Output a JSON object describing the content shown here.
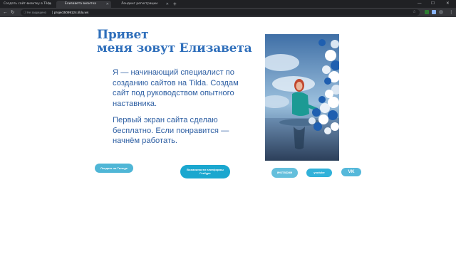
{
  "browser": {
    "tabs": [
      {
        "label": "Создать сайт-визитку в Tilda",
        "active": false
      },
      {
        "label": "Елизавета визитка",
        "active": true
      },
      {
        "label": "Лендинг регистрации",
        "active": false
      }
    ],
    "new_tab_label": "+",
    "window_controls": {
      "minimize": "—",
      "maximize": "☐",
      "close": "✕"
    },
    "nav": {
      "back": "←",
      "forward": "→",
      "reload": "↻"
    },
    "address": {
      "security_label": "Не защищено",
      "url": "project5099124.tilda.ws"
    },
    "menu_icon": "⋮"
  },
  "page": {
    "title_line1": "Привет",
    "title_line2": "меня зовут Елизавета",
    "paragraph1": "Я — начинающий специалист по созданию сайтов на Tilda. Создам сайт под руководством опытного наставника.",
    "paragraph2": "Первый экран сайта сделаю бесплатно. Если понравится — начнём работать.",
    "buttons": {
      "tilda_link": "Лендинг на Тильде",
      "platform_link_line1": "Возможности платформы",
      "platform_link_line2": "ГетКурс",
      "instagram": "инстаграм",
      "youtube": "youtube",
      "vk": "VK"
    }
  },
  "colors": {
    "title": "#2f6fbb",
    "text": "#2e5fa3",
    "button_accent": "#1aa7cf"
  }
}
